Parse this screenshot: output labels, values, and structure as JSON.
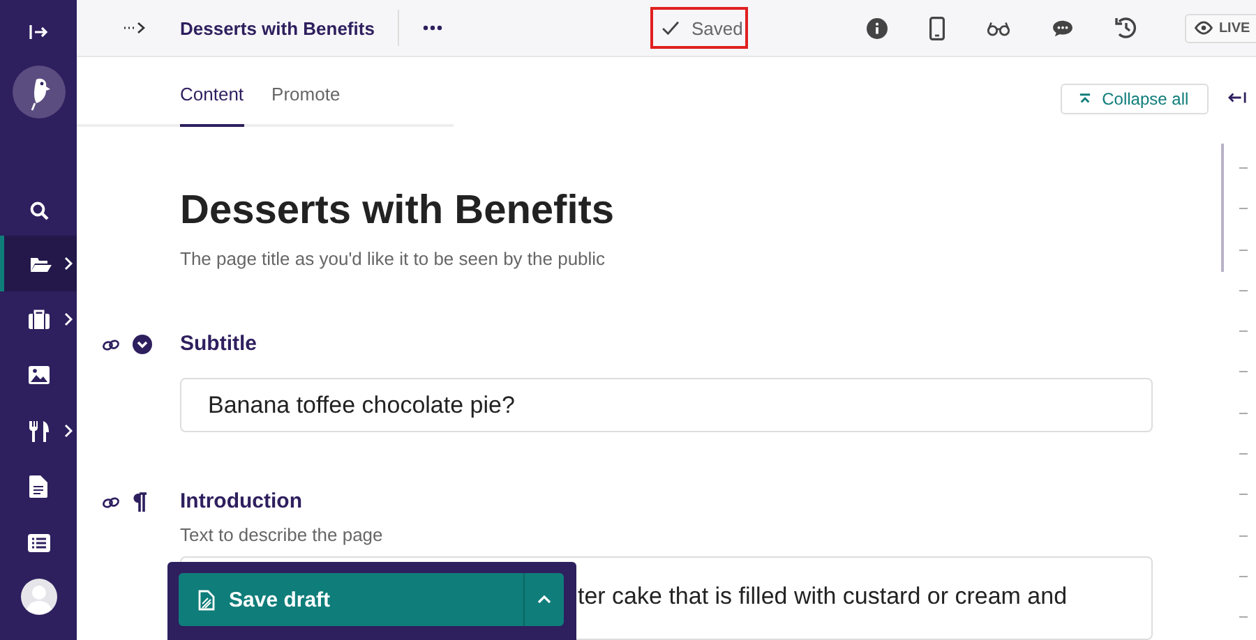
{
  "sidebar": {
    "items": [
      {
        "kind": "search",
        "selected": false,
        "has_submenu": false
      },
      {
        "kind": "folder",
        "selected": true,
        "has_submenu": true
      },
      {
        "kind": "briefcase",
        "selected": false,
        "has_submenu": true
      },
      {
        "kind": "image",
        "selected": false,
        "has_submenu": false
      },
      {
        "kind": "utensils",
        "selected": false,
        "has_submenu": true
      },
      {
        "kind": "document",
        "selected": false,
        "has_submenu": false
      },
      {
        "kind": "list",
        "selected": false,
        "has_submenu": false
      }
    ]
  },
  "header": {
    "title": "Desserts with Benefits",
    "status": "Saved",
    "live_label": "LIVE"
  },
  "tabs": [
    {
      "label": "Content",
      "selected": true
    },
    {
      "label": "Promote",
      "selected": false
    }
  ],
  "collapse_button": "Collapse all",
  "page_title": {
    "value": "Desserts with Benefits",
    "help": "The page title as you'd like it to be seen by the public"
  },
  "fields": [
    {
      "kind": "text",
      "label": "Subtitle",
      "value": "Banana toffee chocolate pie?"
    },
    {
      "kind": "richtext",
      "label": "Introduction",
      "help": "Text to describe the page",
      "value": "ter cake that is filled with custard or cream and"
    }
  ],
  "save": {
    "label": "Save draft"
  }
}
